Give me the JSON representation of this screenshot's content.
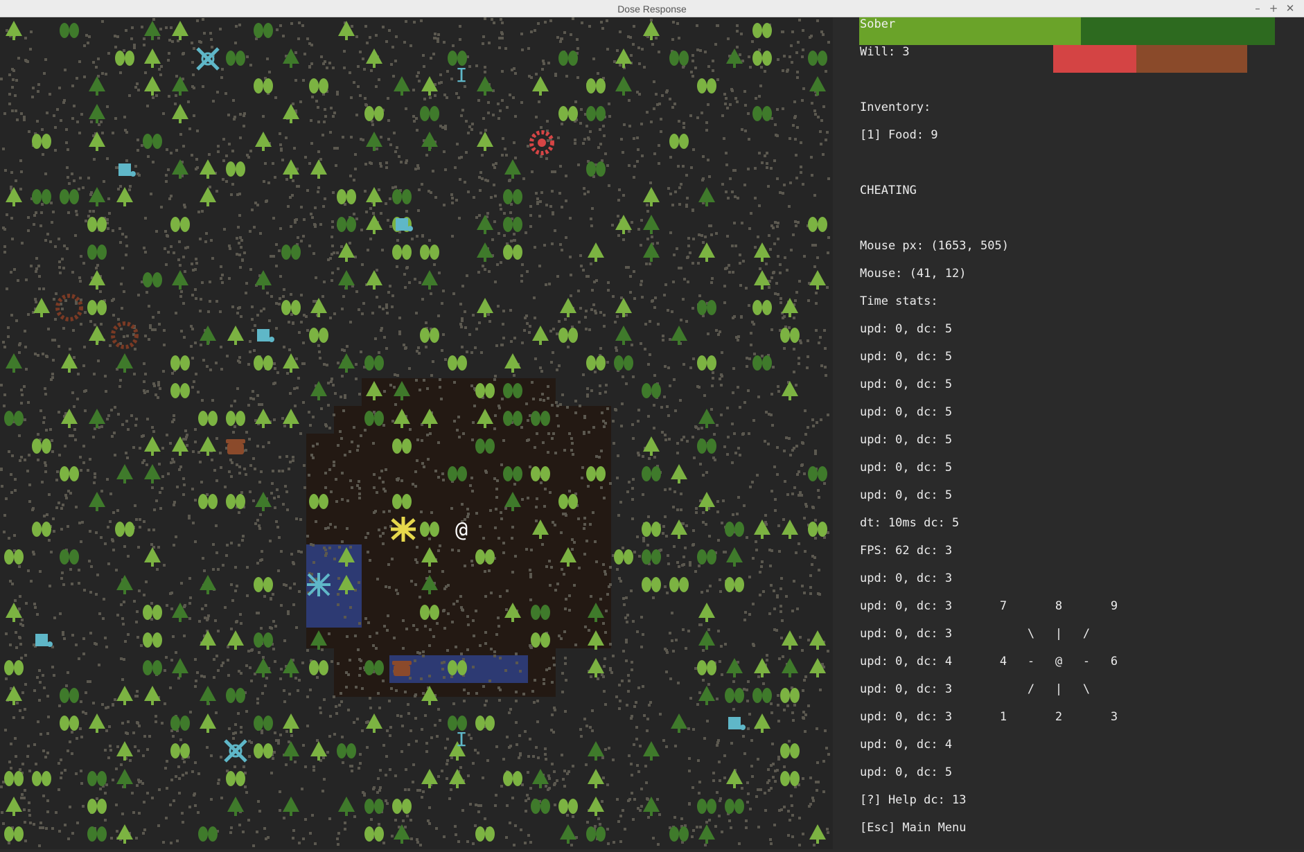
{
  "window": {
    "title": "Dose Response",
    "buttons": [
      "–",
      "+",
      "✕"
    ]
  },
  "status": {
    "state_label": "Sober",
    "state_color": "#6aa329",
    "state_bar_bg": "#2d6a1f",
    "will_label": "Will: 3",
    "will_fill_color": "#d44444",
    "will_bg_color": "#8a4a2a"
  },
  "inventory": {
    "heading": "Inventory:",
    "items": [
      "[1] Food: 9"
    ]
  },
  "cheat_label": "CHEATING",
  "debug": {
    "mouse_px": "Mouse px: (1653, 505)",
    "mouse_cell": "Mouse: (41, 12)",
    "time_stats_heading": "Time stats:",
    "stats": [
      "upd: 0, dc: 5",
      "upd: 0, dc: 5",
      "upd: 0, dc: 5",
      "upd: 0, dc: 5",
      "upd: 0, dc: 5",
      "upd: 0, dc: 5",
      "upd: 0, dc: 5",
      "dt: 10ms dc: 5",
      "FPS: 62 dc: 3",
      "upd: 0, dc: 3",
      "upd: 0, dc: 3",
      "upd: 0, dc: 3",
      "upd: 0, dc: 4",
      "upd: 0, dc: 3",
      "upd: 0, dc: 3",
      "upd: 0, dc: 4",
      "upd: 0, dc: 5",
      "[?] Help dc: 13",
      "[Esc] Main Menu"
    ]
  },
  "numpad": {
    "top": [
      "7",
      "8",
      "9"
    ],
    "upper": [
      "\\",
      "|",
      "/"
    ],
    "middle": [
      "4",
      "-",
      "@",
      "-",
      "6"
    ],
    "lower": [
      "/",
      "|",
      "\\"
    ],
    "bottom": [
      "1",
      "2",
      "3"
    ]
  },
  "map": {
    "colors": {
      "bg": "#252525",
      "ground_dot": "#5b584f",
      "tree_light": "#7cb342",
      "tree_dark": "#3f7a2b",
      "dirt": "#231913",
      "water": "#2d3a73",
      "player": "#ffffff",
      "monster_yellow": "#e6d84c",
      "monster_red": "#d64545",
      "monster_brown": "#8a4a30",
      "dose_cyan": "#5fb7c8",
      "food_brown": "#8b4a2b"
    },
    "entities": [
      {
        "kind": "player",
        "glyph": "@"
      },
      {
        "kind": "dose",
        "glyph": "I"
      },
      {
        "kind": "dose",
        "glyph": "I"
      }
    ]
  }
}
